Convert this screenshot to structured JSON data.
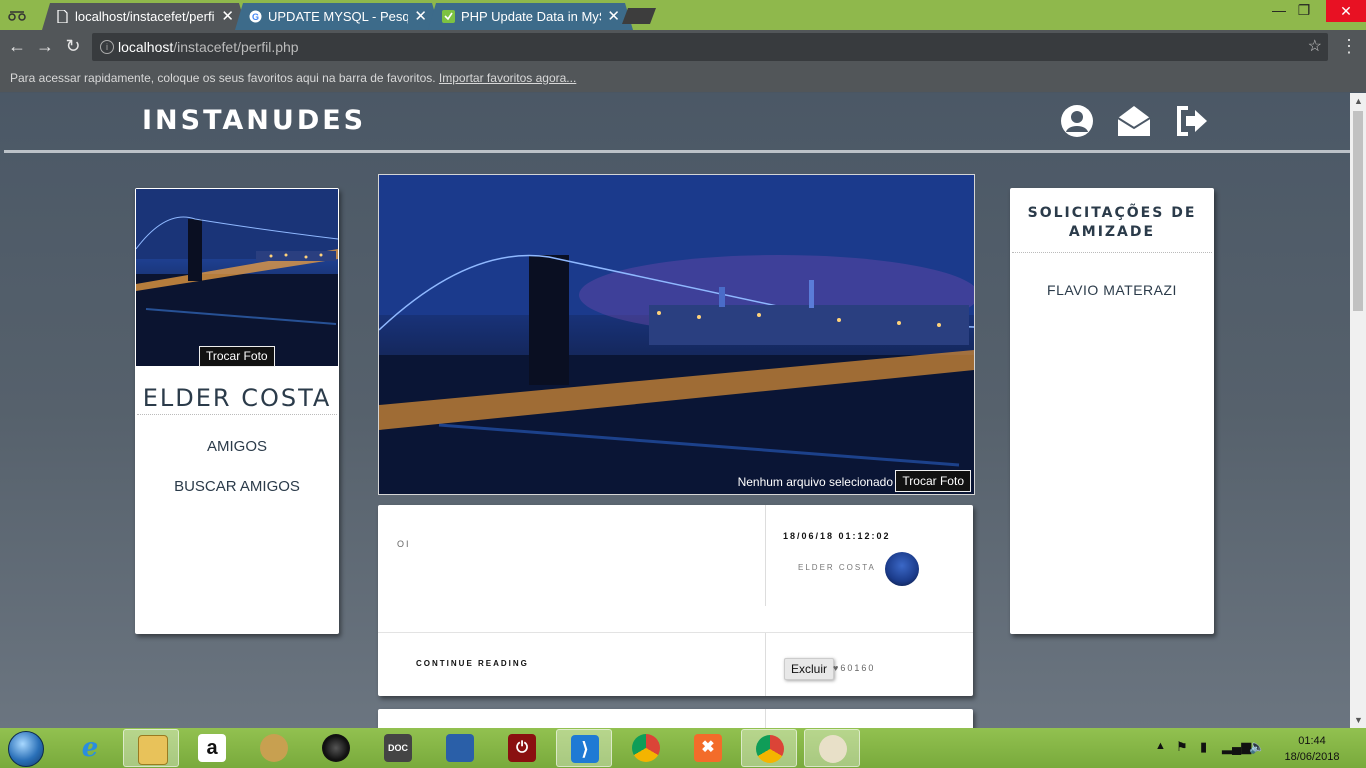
{
  "browser": {
    "tabs": [
      {
        "title": "localhost/instacefet/perfil",
        "close": "✕"
      },
      {
        "title": "UPDATE MYSQL - Pesquisa",
        "close": "✕"
      },
      {
        "title": "PHP Update Data in MySQL",
        "close": "✕"
      }
    ],
    "window_controls": {
      "minimize": "—",
      "restore": "❐",
      "close": "✕"
    },
    "nav": {
      "back": "←",
      "forward": "→",
      "reload": "↻"
    },
    "url_host": "localhost",
    "url_path": "/instacefet/perfil.php",
    "star": "☆",
    "menu": "⋮",
    "bookmarks_message": "Para acessar rapidamente, coloque os seus favoritos aqui na barra de favoritos.",
    "bookmarks_link": "Importar favoritos agora..."
  },
  "header": {
    "brand": "INSTANUDES",
    "icons": [
      "user-circle-icon",
      "envelope-open-icon",
      "sign-out-icon"
    ]
  },
  "profile": {
    "change_photo": "Trocar Foto",
    "name": "ELDER COSTA",
    "links": [
      "AMIGOS",
      "BUSCAR AMIGOS"
    ]
  },
  "cover": {
    "file_status": "Nenhum arquivo selecionado",
    "change_photo": "Trocar Foto"
  },
  "post": {
    "text": "OI",
    "date": "18/06/18 01:12:02",
    "author": "ELDER COSTA",
    "continue": "CONTINUE READING",
    "delete": "Excluir",
    "likes": "♥60160"
  },
  "requests": {
    "title": "SOLICITAÇÕES DE AMIZADE",
    "items": [
      "FLAVIO MATERAZI"
    ]
  },
  "taskbar": {
    "apps": [
      "internet-explorer-icon",
      "file-explorer-icon",
      "amazon-icon",
      "media-player-icon",
      "speaker-icon",
      "doc-scanner-icon",
      "control-panel-icon",
      "power-icon",
      "vscode-icon",
      "chrome-icon",
      "xampp-icon",
      "chrome-icon",
      "paint-icon"
    ],
    "time": "01:44",
    "date": "18/06/2018"
  },
  "colors": {
    "taskbar_green": "#8fb84c",
    "page_bg": "#4b5866",
    "text_dark": "#2b3b4a"
  }
}
